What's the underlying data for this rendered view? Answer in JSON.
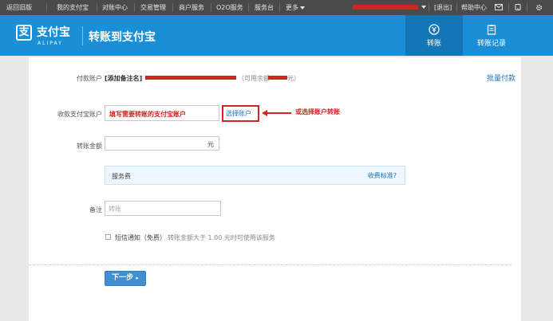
{
  "topnav": {
    "items": [
      "返回旧版",
      "我的支付宝",
      "对账中心",
      "交易管理",
      "商户服务",
      "O2O服务",
      "服务台",
      "更多"
    ],
    "logout": "[退出]",
    "help": "帮助中心"
  },
  "header": {
    "logo_mark": "支",
    "logo_text": "支付宝",
    "logo_sub": "ALIPAY",
    "title": "转账到支付宝",
    "tab_transfer": "转账",
    "tab_records": "转账记录"
  },
  "form": {
    "payer_label": "付款账户",
    "payer_value": "[添加备注名]",
    "balance_prefix": "（可用余额",
    "balance_suffix": "元）",
    "batch_pay": "批量付款",
    "payee_label": "收款支付宝账户",
    "payee_hint": "填写需要转账的支付宝账户",
    "select_account": "选择账户",
    "select_annotation": "或选择账户转账",
    "amount_label": "转账金额",
    "amount_unit": "元",
    "fee_label": "服务费",
    "fee_link": "收费标准?",
    "memo_label": "备注",
    "memo_placeholder": "转账",
    "sms_label": "短信通知（免费）",
    "sms_note": "转账金额大于 1.00 元时可使用该服务",
    "next_button": "下一步"
  },
  "colors": {
    "header_blue": "#1b8fd6",
    "active_tab": "#1576b5",
    "annotation_red": "#d0261f",
    "button_blue": "#3f8fd2"
  }
}
